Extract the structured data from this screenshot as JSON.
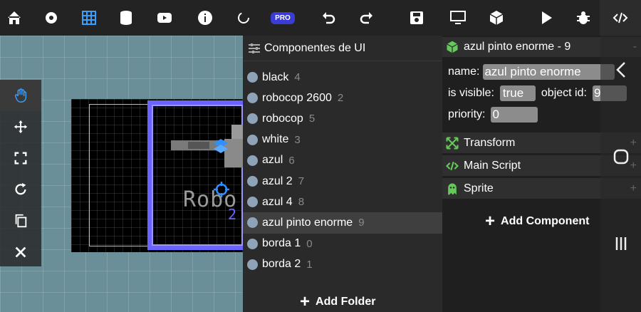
{
  "toolbar": {
    "icons": [
      "home-icon",
      "gear-icon",
      "grid-icon",
      "database-icon",
      "youtube-icon",
      "info-icon",
      "refresh-icon",
      "pro-badge",
      "undo-icon",
      "redo-icon",
      "save-icon",
      "monitor-icon",
      "cube-icon",
      "play-icon",
      "bug-icon",
      "code-icon"
    ],
    "pro_label": "PRO"
  },
  "left_tools": [
    "hand-icon",
    "move-icon",
    "fullscreen-icon",
    "rotate-icon",
    "copy-icon",
    "close-icon"
  ],
  "scene": {
    "text": "Robo",
    "number": "2"
  },
  "hierarchy": {
    "title": "Componentes de UI",
    "items": [
      {
        "label": "black",
        "count": "4"
      },
      {
        "label": "robocop 2600",
        "count": "2"
      },
      {
        "label": "robocop",
        "count": "5"
      },
      {
        "label": "white",
        "count": "3"
      },
      {
        "label": "azul",
        "count": "6"
      },
      {
        "label": "azul 2",
        "count": "7"
      },
      {
        "label": "azul 4",
        "count": "8"
      },
      {
        "label": "azul pinto enorme",
        "count": "9"
      },
      {
        "label": "borda 1",
        "count": "0"
      },
      {
        "label": "borda 2",
        "count": "1"
      }
    ],
    "add_folder": "Add Folder"
  },
  "inspector": {
    "title": "azul pinto enorme - 9",
    "collapse": "-",
    "name_label": "name:",
    "name_value": "azul pinto enorme",
    "visible_label": "is visible:",
    "visible_value": "true",
    "objid_label": "object id:",
    "objid_value": "9",
    "priority_label": "priority:",
    "priority_value": "0",
    "sections": [
      {
        "label": "Transform",
        "icon": "transform-icon",
        "color": "#66c85a"
      },
      {
        "label": "Main Script",
        "icon": "code-icon",
        "color": "#66c85a"
      },
      {
        "label": "Sprite",
        "icon": "ghost-icon",
        "color": "#66c85a"
      }
    ],
    "add_component": "Add Component"
  },
  "colors": {
    "accent": "#6b63ff",
    "green": "#66c85a",
    "pro": "#3b3bd6"
  }
}
